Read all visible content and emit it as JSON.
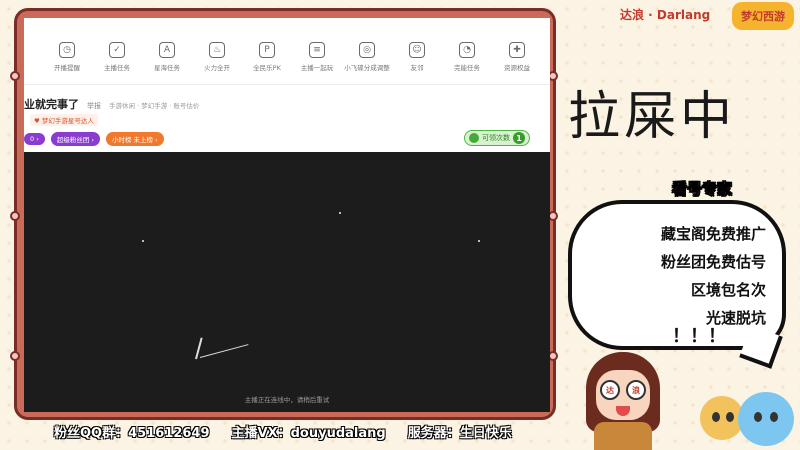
{
  "brand": {
    "name": "达浪 · Darlang",
    "logo_text": "梦幻西游"
  },
  "status_big": "拉屎中",
  "nav": {
    "items": [
      {
        "label": "开播提醒",
        "icon": "alarm-clock-icon",
        "glyph": "◷"
      },
      {
        "label": "主播任务",
        "icon": "task-list-icon",
        "glyph": "✓"
      },
      {
        "label": "星海任务",
        "icon": "ad-icon",
        "glyph": "A"
      },
      {
        "label": "火力全开",
        "icon": "flame-icon",
        "glyph": "♨"
      },
      {
        "label": "全民乐PK",
        "icon": "pk-icon",
        "glyph": "P"
      },
      {
        "label": "主播一起玩",
        "icon": "clipboard-icon",
        "glyph": "≡"
      },
      {
        "label": "小飞碟分成调整",
        "icon": "ufo-icon",
        "glyph": "◎"
      },
      {
        "label": "友邻",
        "icon": "friends-icon",
        "glyph": "☺"
      },
      {
        "label": "完能任务",
        "icon": "gauge-icon",
        "glyph": "◔"
      },
      {
        "label": "资源权益",
        "icon": "gamepad-icon",
        "glyph": "✚"
      }
    ]
  },
  "room": {
    "title": "业就完事了",
    "report_label": "举报",
    "tags": "手游休闲 · 梦幻手游 · 账号估价",
    "rank_tag": "梦幻手游星号达人"
  },
  "pills": {
    "level": "0 ›",
    "fans_club": "超级粉丝团 ›",
    "hour_rank": "小时榜 未上榜 ›"
  },
  "collect_count": {
    "label": "可领次数",
    "value": "1"
  },
  "video": {
    "status_text": "主播正在连线中，请稍后重试"
  },
  "bubble": {
    "header": "看号专家",
    "lines": [
      "藏宝阁免费推广",
      "粉丝团免费估号",
      "区境包名次",
      "光速脱坑"
    ],
    "exclaim": "！！！"
  },
  "avatar": {
    "left_eye": "达",
    "right_eye": "浪"
  },
  "bottom_bar": {
    "fan_group": "粉丝QQ群：451612649",
    "vx": "主播VX：douyudalang",
    "server": "服务器：生日快乐"
  }
}
